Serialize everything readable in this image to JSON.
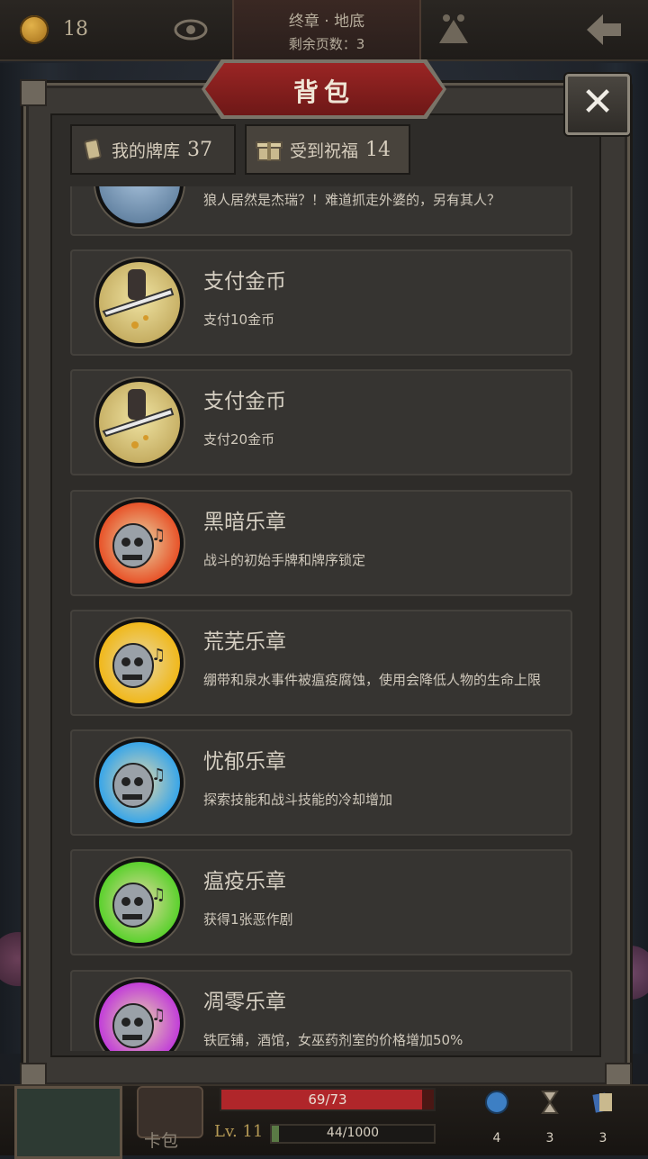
{
  "topbar": {
    "coins": "18",
    "chapter_title": "终章 · 地底",
    "pages_left": "剩余页数：3"
  },
  "panel": {
    "title": "背包",
    "close_label": "✕"
  },
  "tabs": [
    {
      "label": "我的牌库",
      "count": "37"
    },
    {
      "label": "受到祝福",
      "count": "14"
    }
  ],
  "items": [
    {
      "name": "",
      "desc": "狼人居然是杰瑞？！难道抓走外婆的，另有其人？",
      "icon": "moon-icon",
      "color": "#6f8fb0"
    },
    {
      "name": "支付金币",
      "desc": "支付10金币",
      "icon": "sword-coins-icon",
      "color": "#d9c46a"
    },
    {
      "name": "支付金币",
      "desc": "支付20金币",
      "icon": "sword-coins-icon",
      "color": "#d9c46a"
    },
    {
      "name": "黑暗乐章",
      "desc": "战斗的初始手牌和牌序锁定",
      "icon": "skull-music-icon",
      "color": "#e8542a"
    },
    {
      "name": "荒芜乐章",
      "desc": "绷带和泉水事件被瘟疫腐蚀，使用会降低人物的生命上限",
      "icon": "skull-music-icon",
      "color": "#f0b81c"
    },
    {
      "name": "忧郁乐章",
      "desc": "探索技能和战斗技能的冷却增加",
      "icon": "skull-music-icon",
      "color": "#3aa6e8"
    },
    {
      "name": "瘟疫乐章",
      "desc": "获得1张恶作剧",
      "icon": "skull-music-icon",
      "color": "#5cd12e"
    },
    {
      "name": "凋零乐章",
      "desc": "铁匠铺，酒馆，女巫药剂室的价格增加50%",
      "icon": "skull-music-icon",
      "color": "#c23fd8"
    }
  ],
  "bottombar": {
    "cardbag_label": "卡包",
    "hp_text": "69/73",
    "hp_fraction": 0.945,
    "level": "Lv. 11",
    "xp_text": "44/1000",
    "xp_fraction": 0.044,
    "resources": [
      {
        "icon": "globe-icon",
        "value": "4"
      },
      {
        "icon": "hourglass-icon",
        "value": "3"
      },
      {
        "icon": "cards-icon",
        "value": "3"
      }
    ]
  }
}
